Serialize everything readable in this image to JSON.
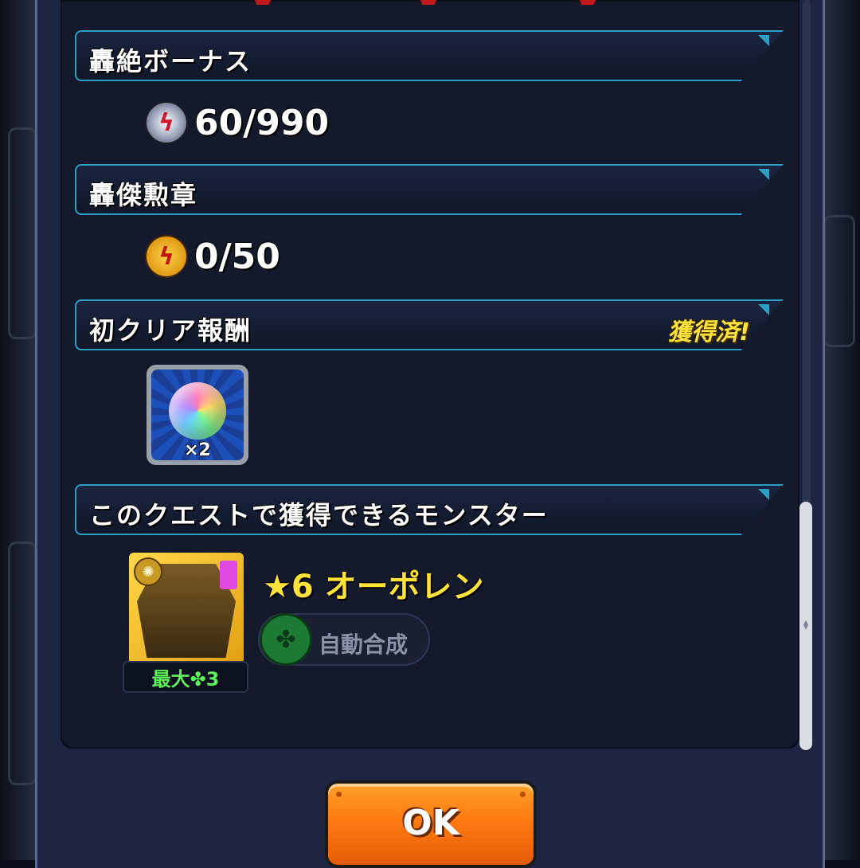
{
  "sections": {
    "bonus": {
      "title": "轟絶ボーナス",
      "value": "60/990",
      "icon": "lightning-bonus-icon"
    },
    "medal": {
      "title": "轟傑勲章",
      "value": "0/50",
      "icon": "lightning-medal-icon"
    },
    "first_clear": {
      "title": "初クリア報酬",
      "badge": "獲得済!",
      "item_icon": "rainbow-orb-icon",
      "item_qty": "×2"
    },
    "monsters": {
      "title": "このクエストで獲得できるモンスター"
    }
  },
  "monster": {
    "name": "★6 オーポレン",
    "sub_label": "最大✤3",
    "auto_label": "自動合成",
    "auto_icon": "clover-icon"
  },
  "buttons": {
    "ok_label": "OK"
  },
  "colors": {
    "accent_border": "#2b9fc4",
    "badge_yellow": "#ffe23a",
    "ok_orange": "#ff7a12",
    "clover_green": "#5ef05e"
  }
}
